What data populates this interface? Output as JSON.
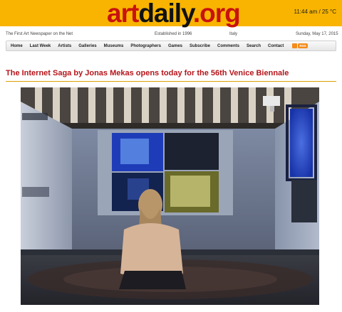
{
  "header": {
    "logo": {
      "art": "art",
      "daily": "daily",
      "org": ".org"
    },
    "clock": "11:44 am / 25 °C",
    "colors": {
      "bar": "#f8b400",
      "logo_red": "#c8120e",
      "headline_red": "#b5151b"
    }
  },
  "infobar": {
    "tagline": "The First Art Newspaper on the Net",
    "established": "Established in 1996",
    "country": "Italy",
    "date": "Sunday, May 17, 2015"
  },
  "nav": {
    "items": [
      "Home",
      "Last Week",
      "Artists",
      "Galleries",
      "Museums",
      "Photographers",
      "Games",
      "Subscribe",
      "Comments",
      "Search",
      "Contact"
    ],
    "rss_label": "RSS"
  },
  "article": {
    "headline": "The Internet Saga by Jonas Mekas opens today for the 56th Venice Biennale"
  }
}
